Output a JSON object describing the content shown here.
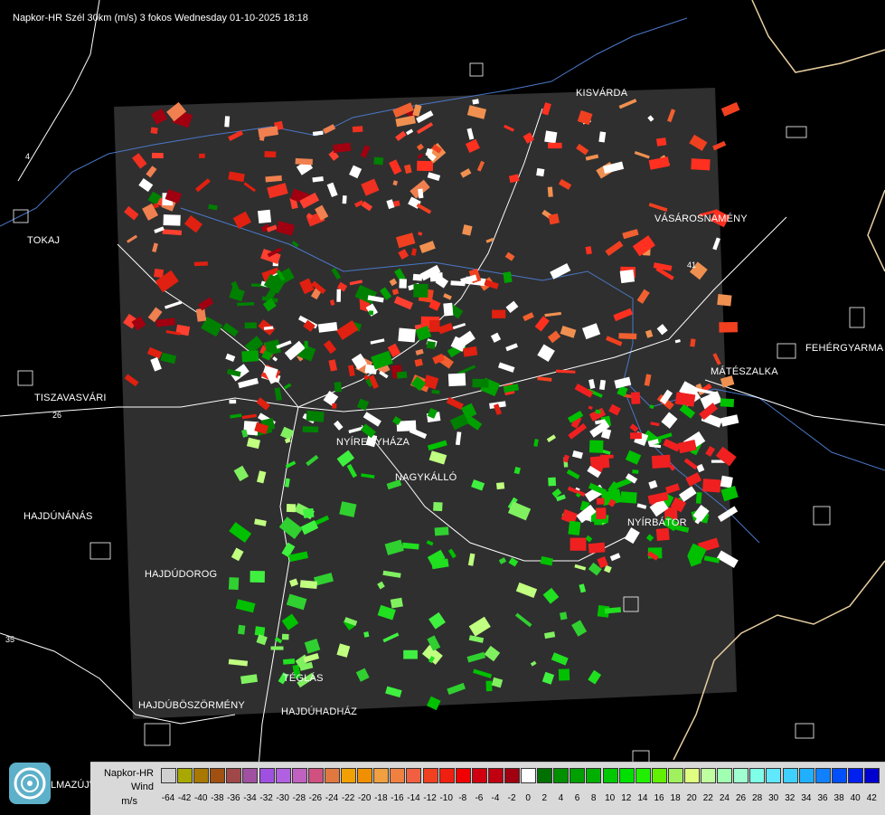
{
  "title": "Napkor-HR Szél 30km (m/s) 3 fokos Wednesday 01-10-2025 18:18",
  "cities": [
    {
      "name": "KISVÁRDA",
      "key": "kisvarda"
    },
    {
      "name": "TOKAJ",
      "key": "tokaj"
    },
    {
      "name": "VÁSÁROSNAMÉNY",
      "key": "vasarosnameny"
    },
    {
      "name": "FEHÉRGYARMA",
      "key": "fehergyarmat"
    },
    {
      "name": "MÁTÉSZALKA",
      "key": "mateszalka"
    },
    {
      "name": "TISZAVASVÁRI",
      "key": "tiszavasvari"
    },
    {
      "name": "NYÍREGYHÁZA",
      "key": "nyiregyhaza"
    },
    {
      "name": "NAGYKÁLLÓ",
      "key": "nagykallo"
    },
    {
      "name": "HAJDÚNÁNÁS",
      "key": "hajdunanas"
    },
    {
      "name": "NYÍRBÁTOR",
      "key": "nyirbator"
    },
    {
      "name": "HAJDÚDOROG",
      "key": "hajdudorog"
    },
    {
      "name": "TÉGLÁS",
      "key": "teglas"
    },
    {
      "name": "HAJDÚBÖSZÖRMÉNY",
      "key": "hajduboszormeny"
    },
    {
      "name": "HAJDÚHADHÁZ",
      "key": "hajduhadhaz"
    },
    {
      "name": "LMAZÚJVÁR",
      "key": "lmazujvar"
    }
  ],
  "road_labels": [
    "26",
    "35",
    "41",
    "4"
  ],
  "legend": {
    "product": "Napkor-HR",
    "quantity": "Wind",
    "unit": "m/s",
    "values": [
      "-64",
      "-42",
      "-40",
      "-38",
      "-36",
      "-34",
      "-32",
      "-30",
      "-28",
      "-26",
      "-24",
      "-22",
      "-20",
      "-18",
      "-16",
      "-14",
      "-12",
      "-10",
      "-8",
      "-6",
      "-4",
      "-2",
      "0",
      "2",
      "4",
      "6",
      "8",
      "10",
      "12",
      "14",
      "16",
      "18",
      "20",
      "22",
      "24",
      "26",
      "28",
      "30",
      "32",
      "34",
      "36",
      "38",
      "40",
      "42"
    ],
    "colors": [
      "#d0d0d0",
      "#a8a800",
      "#a87800",
      "#a05010",
      "#a04848",
      "#a050a0",
      "#a050e0",
      "#b060e0",
      "#c060c0",
      "#d05080",
      "#e07840",
      "#f0a000",
      "#f09000",
      "#f0a040",
      "#f08040",
      "#f06040",
      "#f04020",
      "#f02010",
      "#f00000",
      "#d00010",
      "#c00010",
      "#a00010",
      "#ffffff",
      "#007000",
      "#009000",
      "#00a000",
      "#00b000",
      "#00c800",
      "#00e000",
      "#20f000",
      "#60f000",
      "#a0f060",
      "#e0ff80",
      "#c0ffa0",
      "#a0ffb0",
      "#a0ffd0",
      "#80ffe8",
      "#60e8ff",
      "#40d0ff",
      "#20b0ff",
      "#1080ff",
      "#0050ff",
      "#0020f0",
      "#0000d0"
    ]
  }
}
